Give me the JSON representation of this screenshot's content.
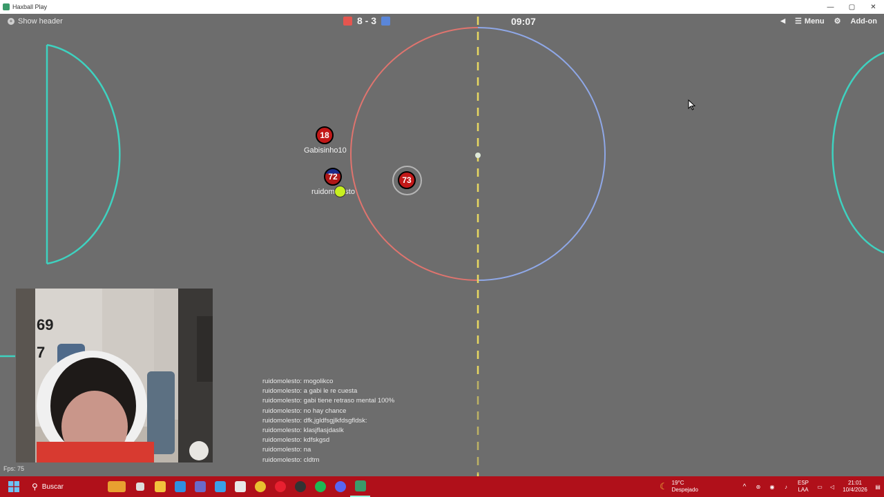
{
  "window": {
    "title": "Haxball Play",
    "controls": [
      "—",
      "▢",
      "✕"
    ]
  },
  "topbar": {
    "show_header_label": "Show header",
    "score": "8 - 3",
    "red_color": "#e5554f",
    "blue_color": "#5a86d9",
    "timer": "09:07",
    "menu_label": "Menu",
    "addon_label": "Add-on"
  },
  "field": {
    "line_color": "#3ed2c0",
    "center_left_arc_color": "#e0746e",
    "center_right_arc_color": "#8fa8e8",
    "midline_color": "#e8d860"
  },
  "players": [
    {
      "number": "18",
      "name": "Gabisinho10",
      "team": "red"
    },
    {
      "number": "72",
      "name": "ruidomolesto",
      "team": "red"
    },
    {
      "number": "73",
      "name": "",
      "team": "red"
    }
  ],
  "chat": [
    "ruidomolesto: mogolikco",
    "ruidomolesto: a gabi le re cuesta",
    "ruidomolesto: gabi tiene retraso mental 100%",
    "ruidomolesto: no hay chance",
    "ruidomolesto: dfk,jgldfsgjlkfdsgfldsk:",
    "ruidomolesto: klasjflasjdaslk",
    "ruidomolesto: kdfskgsd",
    "ruidomolesto: na",
    "ruidomolesto: cldtm"
  ],
  "fps": "Fps: 75",
  "webcam": {
    "poster_text_1": "69",
    "poster_text_2": "7"
  },
  "taskbar": {
    "search_label": "Buscar",
    "weather_temp": "19°C",
    "weather_desc": "Despejado",
    "lang_line1": "ESP",
    "lang_line2": "LAA",
    "time": "21:01",
    "date": "10/4/2026"
  }
}
